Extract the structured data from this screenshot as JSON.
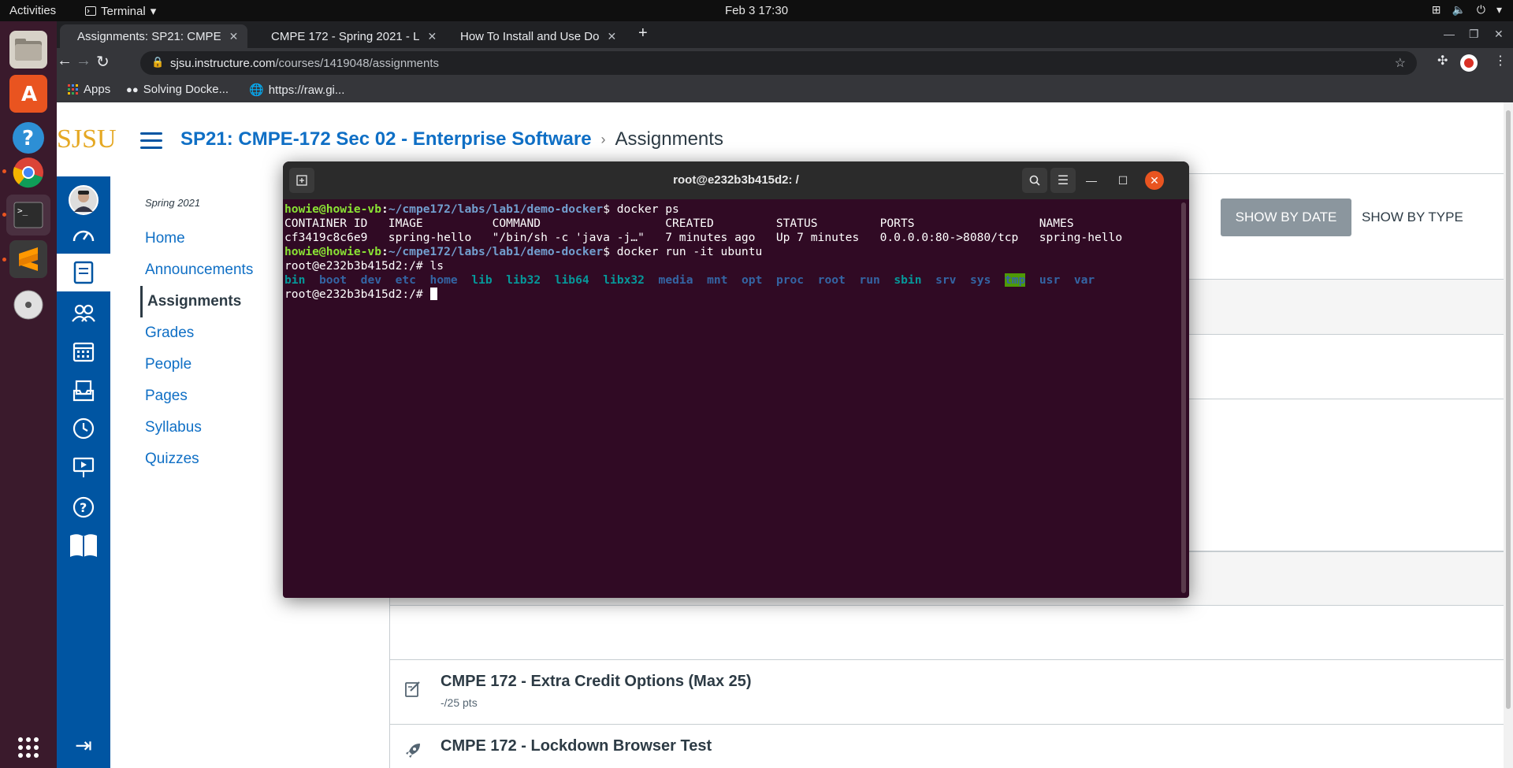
{
  "topbar": {
    "activities": "Activities",
    "app_name": "Terminal",
    "clock": "Feb 3  17:30"
  },
  "chrome": {
    "tabs": [
      {
        "title": "Assignments: SP21: CMPE"
      },
      {
        "title": "CMPE 172 - Spring 2021 - L"
      },
      {
        "title": "How To Install and Use Do"
      }
    ],
    "url_host": "sjsu.instructure.com",
    "url_path": "/courses/1419048/assignments",
    "bookmarks": [
      {
        "label": "Apps"
      },
      {
        "label": "Solving Docke..."
      },
      {
        "label": "https://raw.gi..."
      }
    ]
  },
  "canvas": {
    "logo": "SJSU",
    "breadcrumb_course": "SP21: CMPE-172 Sec 02 - Enterprise Software",
    "breadcrumb_current": "Assignments",
    "term": "Spring 2021",
    "course_nav": [
      {
        "label": "Home"
      },
      {
        "label": "Announcements"
      },
      {
        "label": "Assignments"
      },
      {
        "label": "Grades"
      },
      {
        "label": "People"
      },
      {
        "label": "Pages"
      },
      {
        "label": "Syllabus"
      },
      {
        "label": "Quizzes"
      }
    ],
    "show_by_date": "SHOW BY DATE",
    "show_by_type": "SHOW BY TYPE",
    "assignments": [
      {
        "title": "CMPE 172 - Extra Credit Options (Max 25)",
        "points": "-/25 pts"
      },
      {
        "title": "CMPE 172 - Lockdown Browser Test",
        "points": ""
      }
    ]
  },
  "terminal": {
    "title": "root@e232b3b415d2: /",
    "user_host": "howie@howie-vb",
    "path": "~/cmpe172/labs/lab1/demo-docker",
    "cmd1": "docker ps",
    "ps_header": "CONTAINER ID   IMAGE          COMMAND                  CREATED         STATUS         PORTS                  NAMES",
    "ps_row": "cf3419c8c6e9   spring-hello   \"/bin/sh -c 'java -j…\"   7 minutes ago   Up 7 minutes   0.0.0.0:80->8080/tcp   spring-hello",
    "cmd2": "docker run -it ubuntu",
    "root_prompt": "root@e232b3b415d2:/# ",
    "cmd3": "ls",
    "ls_entries": [
      {
        "name": "bin",
        "kind": "link"
      },
      {
        "name": "boot",
        "kind": "dir"
      },
      {
        "name": "dev",
        "kind": "dir"
      },
      {
        "name": "etc",
        "kind": "dir"
      },
      {
        "name": "home",
        "kind": "dir"
      },
      {
        "name": "lib",
        "kind": "link"
      },
      {
        "name": "lib32",
        "kind": "link"
      },
      {
        "name": "lib64",
        "kind": "link"
      },
      {
        "name": "libx32",
        "kind": "link"
      },
      {
        "name": "media",
        "kind": "dir"
      },
      {
        "name": "mnt",
        "kind": "dir"
      },
      {
        "name": "opt",
        "kind": "dir"
      },
      {
        "name": "proc",
        "kind": "dir"
      },
      {
        "name": "root",
        "kind": "dir"
      },
      {
        "name": "run",
        "kind": "dir"
      },
      {
        "name": "sbin",
        "kind": "link"
      },
      {
        "name": "srv",
        "kind": "dir"
      },
      {
        "name": "sys",
        "kind": "dir"
      },
      {
        "name": "tmp",
        "kind": "tmp"
      },
      {
        "name": "usr",
        "kind": "dir"
      },
      {
        "name": "var",
        "kind": "dir"
      }
    ]
  },
  "colors": {
    "terminal_bg": "#300a24",
    "canvas_blue": "#0055a2",
    "sjsu_gold": "#e5a823",
    "link_blue": "#0f6fc5",
    "ubuntu_orange": "#e95420"
  }
}
